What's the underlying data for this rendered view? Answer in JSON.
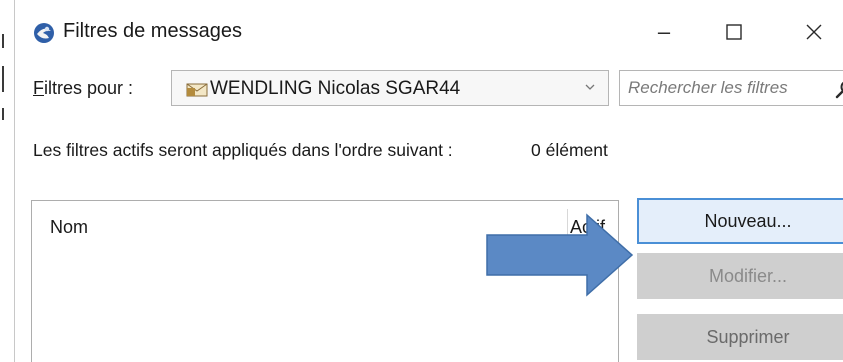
{
  "window": {
    "title": "Filtres de messages",
    "minimize_glyph": "–",
    "maximize_glyph": "☐",
    "close_glyph": "✕",
    "app_icon": "thunderbird-logo-icon"
  },
  "filters_for": {
    "label": "Filtres pour :",
    "account": "WENDLING Nicolas SGAR44",
    "account_icon": "mail-account-icon",
    "dropdown_icon": "chevron-down-icon"
  },
  "search": {
    "placeholder": "Rechercher les filtres",
    "icon": "search-icon"
  },
  "info": {
    "description": "Les filtres actifs seront appliqués dans l'ordre suivant :",
    "count": "0 élément"
  },
  "list": {
    "columns": {
      "name": "Nom",
      "active": "Actif"
    },
    "rows": []
  },
  "buttons": {
    "new": "Nouveau...",
    "edit": "Modifier...",
    "delete": "Supprimer"
  },
  "annotation": {
    "arrow_color": "#5b89c5",
    "arrow_border_color": "#3f6ea8",
    "points_to": "new-filter-button"
  },
  "colors": {
    "primary_button_border": "#4a8fd6",
    "primary_button_bg": "#e4eefa",
    "disabled_button_bg": "#cfcfcf"
  }
}
